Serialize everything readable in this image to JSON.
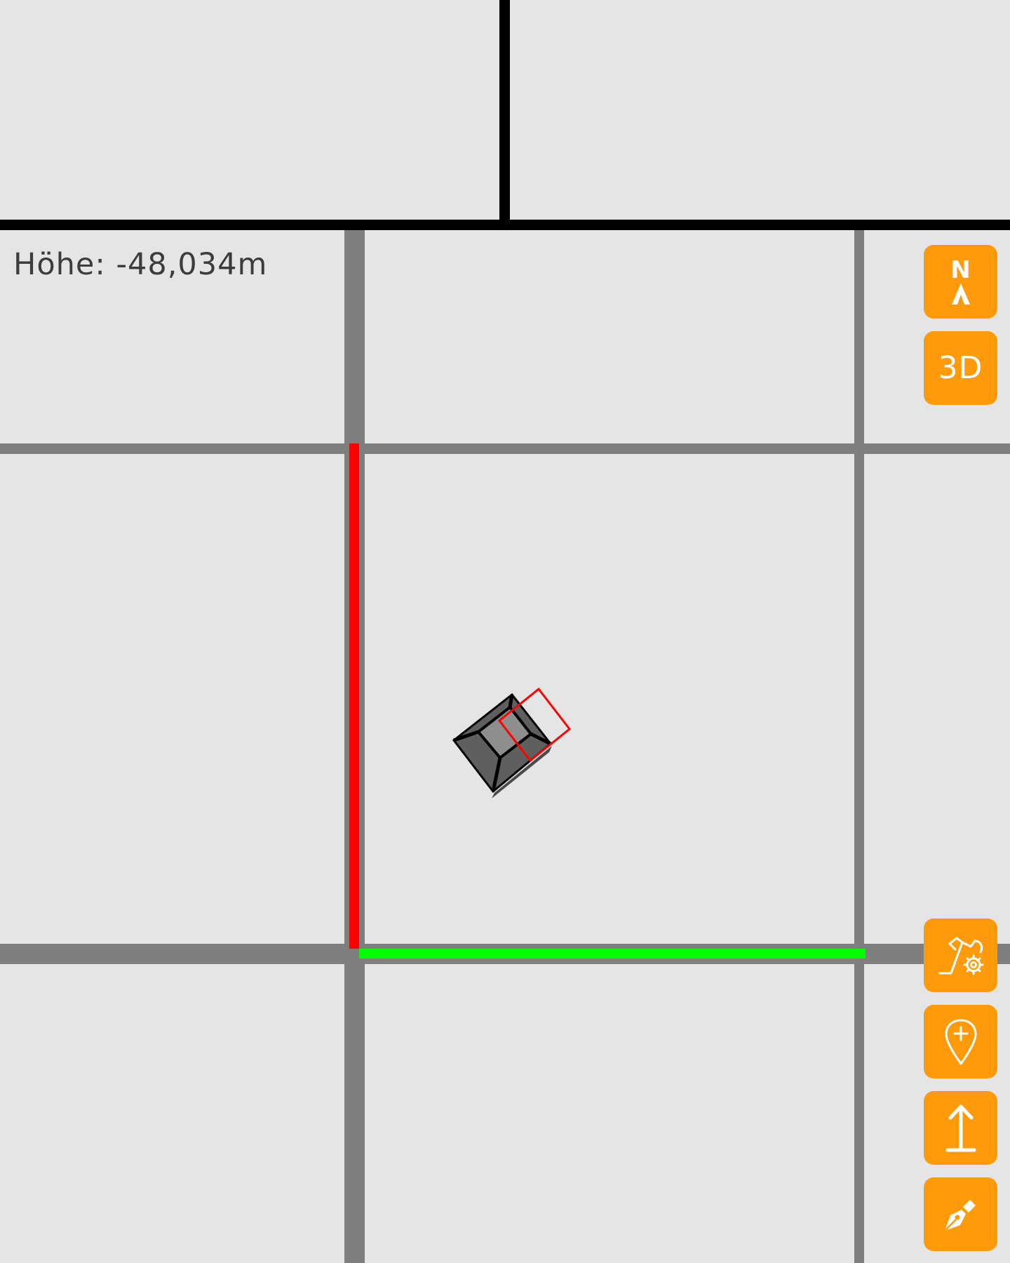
{
  "status": {
    "height_label": "Höhe:",
    "height_value": "-48,034m"
  },
  "controls": {
    "north_label": "N",
    "view_3d_label": "3D"
  },
  "icons": {
    "north": "north-arrow-icon",
    "machine_settings": "excavator-gear-icon",
    "add_point": "map-pin-plus-icon",
    "measure_height": "height-arrow-icon",
    "draw": "pen-nib-icon"
  },
  "colors": {
    "accent": "#ff9a0a",
    "background": "#e5e5e5",
    "grid": "#7f7f7f",
    "border": "#000000",
    "axis_vertical": "#ff0000",
    "axis_horizontal": "#00ff00"
  }
}
